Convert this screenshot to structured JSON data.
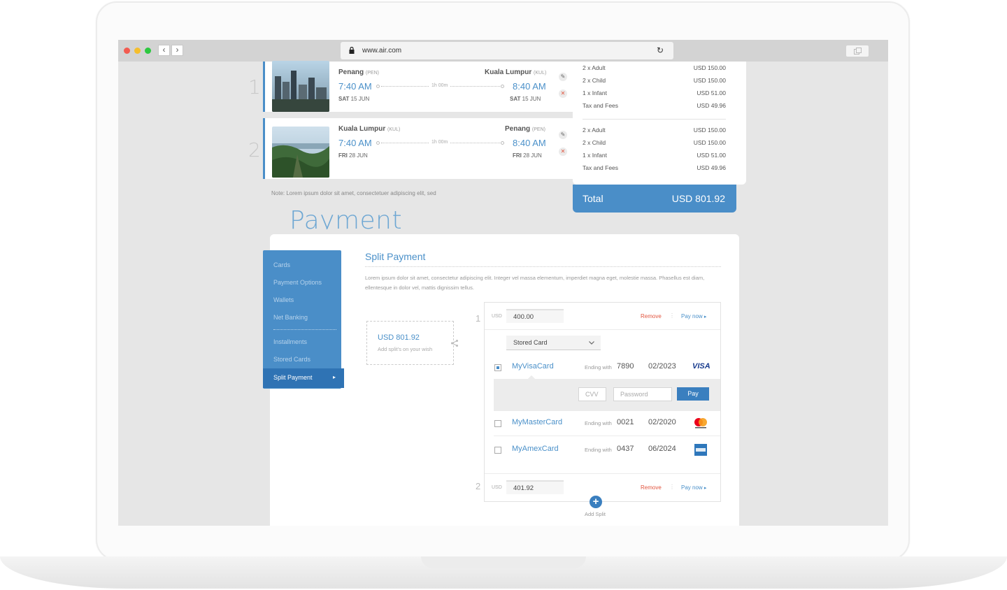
{
  "browser": {
    "url": "www.air.com",
    "back_label": "‹",
    "forward_label": "›",
    "reload_label": "↻"
  },
  "flights": [
    {
      "index": "1",
      "from_city": "Penang",
      "from_code": "(PEN)",
      "to_city": "Kuala Lumpur",
      "to_code": "(KUL)",
      "depart_time": "7:40 AM",
      "arrive_time": "8:40 AM",
      "duration": "1h 00m",
      "depart_day": "SAT",
      "depart_date": "15 JUN",
      "arrive_day": "SAT",
      "arrive_date": "15 JUN"
    },
    {
      "index": "2",
      "from_city": "Kuala Lumpur",
      "from_code": "(KUL)",
      "to_city": "Penang",
      "to_code": "(PEN)",
      "depart_time": "7:40 AM",
      "arrive_time": "8:40 AM",
      "duration": "1h 00m",
      "depart_day": "FRI",
      "depart_date": "28 JUN",
      "arrive_day": "FRI",
      "arrive_date": "28 JUN"
    }
  ],
  "fares": [
    [
      {
        "label": "2 x Adult",
        "value": "USD 150.00"
      },
      {
        "label": "2 x Child",
        "value": "USD 150.00"
      },
      {
        "label": "1 x Infant",
        "value": "USD 51.00"
      },
      {
        "label": "Tax and Fees",
        "value": "USD 49.96"
      }
    ],
    [
      {
        "label": "2 x Adult",
        "value": "USD 150.00"
      },
      {
        "label": "2 x Child",
        "value": "USD 150.00"
      },
      {
        "label": "1 x Infant",
        "value": "USD 51.00"
      },
      {
        "label": "Tax and Fees",
        "value": "USD 49.96"
      }
    ]
  ],
  "total": {
    "label": "Total",
    "value": "USD 801.92"
  },
  "note": "Note: Lorem ipsum dolor sit amet, consectetuer adipiscing elit, sed",
  "payment": {
    "title": "Payment",
    "menu": [
      "Cards",
      "Payment Options",
      "Wallets",
      "Net Banking",
      "Installments",
      "Stored Cards"
    ],
    "active_menu": "Split Payment",
    "split_title": "Split Payment",
    "description": "Lorem ipsum dolor sit amet, consectetur adipiscing elit. Integer vel massa elementum, imperdiet magna eget, molestie massa. Phasellus est diam, ellentesque in dolor vel, mattis dignissim tellus.",
    "wish_amount": "USD 801.92",
    "wish_hint": "Add split's on your wish",
    "splits": [
      {
        "index": "1",
        "currency": "USD",
        "amount": "400.00",
        "remove": "Remove",
        "pay_now": "Pay now"
      },
      {
        "index": "2",
        "currency": "USD",
        "amount": "401.92",
        "remove": "Remove",
        "pay_now": "Pay now"
      }
    ],
    "select_value": "Stored Card",
    "cards": [
      {
        "name": "MyVisaCard",
        "ending_label": "Ending with",
        "ending": "7890",
        "expiry": "02/2023",
        "brand": "VISA",
        "checked": true
      },
      {
        "name": "MyMasterCard",
        "ending_label": "Ending with",
        "ending": "0021",
        "expiry": "02/2020",
        "brand": "mastercard",
        "checked": false
      },
      {
        "name": "MyAmexCard",
        "ending_label": "Ending with",
        "ending": "0437",
        "expiry": "06/2024",
        "brand": "amex",
        "checked": false
      }
    ],
    "cvv_placeholder": "CVV",
    "password_placeholder": "Password",
    "pay_label": "Pay",
    "add_split_label": "Add Split"
  },
  "colors": {
    "accent": "#4a8ec8",
    "remove": "#e2553f"
  }
}
